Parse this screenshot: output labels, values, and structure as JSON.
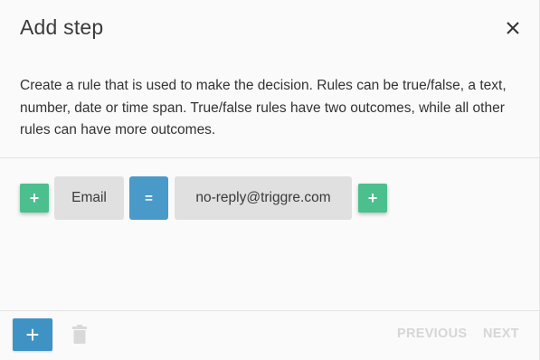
{
  "dialog": {
    "title": "Add step",
    "description": "Create a rule that is used to make the decision. Rules can be true/false, a text, number, date or time span. True/false rules have two outcomes, while all other rules can have more outcomes."
  },
  "rule": {
    "add_before_label": "+",
    "field_label": "Email",
    "operator_label": "=",
    "value_label": "no-reply@triggre.com",
    "add_after_label": "+"
  },
  "footer": {
    "add_label": "+",
    "previous_label": "PREVIOUS",
    "next_label": "NEXT"
  },
  "colors": {
    "green_button": "#4cbf8f",
    "operator_blue": "#4a9ac9",
    "add_blue": "#3e93c4",
    "chip_grey": "#e0e0e0",
    "disabled_text": "#d6d6d6"
  },
  "icons": {
    "close": "close-icon",
    "delete": "trash-icon"
  }
}
